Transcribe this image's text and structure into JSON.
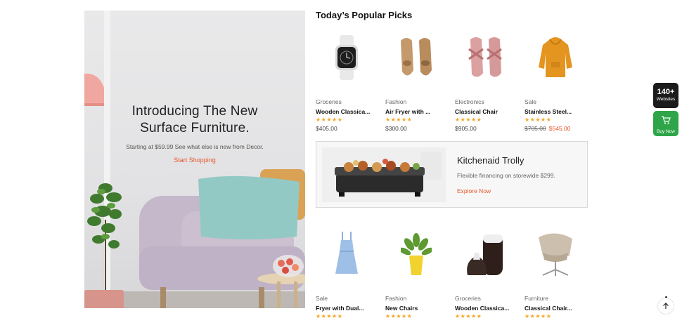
{
  "hero": {
    "title_line1": "Introducing The New",
    "title_line2": "Surface Furniture.",
    "subtitle": "Starting at $59.99 See what else is new from Decor.",
    "cta": "Start Shopping"
  },
  "section": {
    "title": "Today’s Popular Picks"
  },
  "products_row1": [
    {
      "category": "Groceries",
      "name": "Wooden Classica...",
      "stars": "★★★★★",
      "price": "$405.00",
      "icon": "smartwatch-icon"
    },
    {
      "category": "Fashion",
      "name": "Air Fryer with ...",
      "stars": "★★★★★",
      "price": "$300.00",
      "icon": "loafers-icon"
    },
    {
      "category": "Electronics",
      "name": "Classical Chair",
      "stars": "★★★★★",
      "price": "$905.00",
      "icon": "sandals-icon"
    },
    {
      "category": "Sale",
      "name": "Stainless Steel...",
      "stars": "★★★★★",
      "old_price": "$705.00",
      "sale_price": "$545.00",
      "icon": "hoodie-icon"
    }
  ],
  "banner": {
    "title": "Kitchenaid Trolly",
    "subtitle": "Flexible financing on storewide $299.",
    "cta": "Explore Now",
    "icon": "grill-icon"
  },
  "products_row2": [
    {
      "category": "Sale",
      "name": "Fryer with Dual...",
      "stars": "★★★★★",
      "icon": "dress-icon"
    },
    {
      "category": "Fashion",
      "name": "New Chairs",
      "stars": "★★★★★",
      "icon": "potted-plant-icon"
    },
    {
      "category": "Groceries",
      "name": "Wooden Classica...",
      "stars": "★★★★★",
      "icon": "vases-icon"
    },
    {
      "category": "Furniture",
      "name": "Classical Chair...",
      "stars": "★★★★★",
      "icon": "lounge-chair-icon"
    }
  ],
  "widgets": {
    "badge_big": "140+",
    "badge_small": "Websites",
    "buy_label": "Buy Now"
  },
  "colors": {
    "accent": "#e8562a",
    "star": "#f5a623",
    "buy": "#2ea548"
  }
}
